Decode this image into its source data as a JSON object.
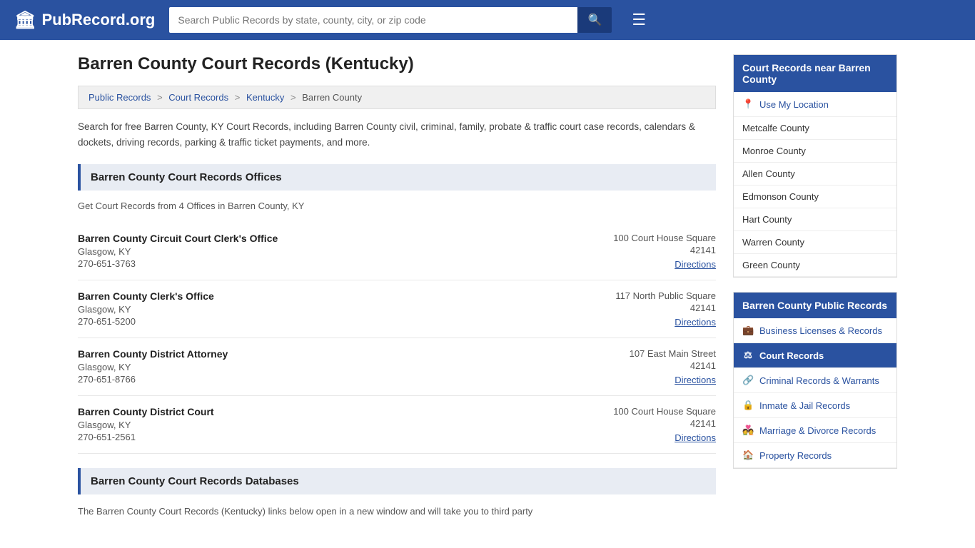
{
  "header": {
    "logo_icon": "🏛",
    "logo_text": "PubRecord.org",
    "search_placeholder": "Search Public Records by state, county, city, or zip code",
    "search_value": "",
    "search_icon": "🔍",
    "menu_icon": "☰"
  },
  "page": {
    "title": "Barren County Court Records (Kentucky)",
    "breadcrumbs": [
      {
        "label": "Public Records",
        "href": "#"
      },
      {
        "label": "Court Records",
        "href": "#"
      },
      {
        "label": "Kentucky",
        "href": "#"
      },
      {
        "label": "Barren County",
        "href": "#"
      }
    ],
    "intro": "Search for free Barren County, KY Court Records, including Barren County civil, criminal, family, probate & traffic court case records, calendars & dockets, driving records, parking & traffic ticket payments, and more.",
    "offices_header": "Barren County Court Records Offices",
    "offices_subtext": "Get Court Records from 4 Offices in Barren County, KY",
    "offices": [
      {
        "name": "Barren County Circuit Court Clerk's Office",
        "city": "Glasgow, KY",
        "phone": "270-651-3763",
        "address": "100 Court House Square",
        "zip": "42141",
        "directions_label": "Directions"
      },
      {
        "name": "Barren County Clerk's Office",
        "city": "Glasgow, KY",
        "phone": "270-651-5200",
        "address": "117 North Public Square",
        "zip": "42141",
        "directions_label": "Directions"
      },
      {
        "name": "Barren County District Attorney",
        "city": "Glasgow, KY",
        "phone": "270-651-8766",
        "address": "107 East Main Street",
        "zip": "42141",
        "directions_label": "Directions"
      },
      {
        "name": "Barren County District Court",
        "city": "Glasgow, KY",
        "phone": "270-651-2561",
        "address": "100 Court House Square",
        "zip": "42141",
        "directions_label": "Directions"
      }
    ],
    "databases_header": "Barren County Court Records Databases",
    "databases_text": "The Barren County Court Records (Kentucky) links below open in a new window and will take you to third party"
  },
  "sidebar": {
    "nearby_header": "Court Records near Barren County",
    "use_location_label": "Use My Location",
    "nearby_counties": [
      "Metcalfe County",
      "Monroe County",
      "Allen County",
      "Edmonson County",
      "Hart County",
      "Warren County",
      "Green County"
    ],
    "public_records_header": "Barren County Public Records",
    "public_records_items": [
      {
        "icon": "💼",
        "label": "Business Licenses & Records",
        "active": false
      },
      {
        "icon": "⚖",
        "label": "Court Records",
        "active": true
      },
      {
        "icon": "🔗",
        "label": "Criminal Records & Warrants",
        "active": false
      },
      {
        "icon": "🔒",
        "label": "Inmate & Jail Records",
        "active": false
      },
      {
        "icon": "💑",
        "label": "Marriage & Divorce Records",
        "active": false
      },
      {
        "icon": "🏠",
        "label": "Property Records",
        "active": false
      }
    ]
  }
}
